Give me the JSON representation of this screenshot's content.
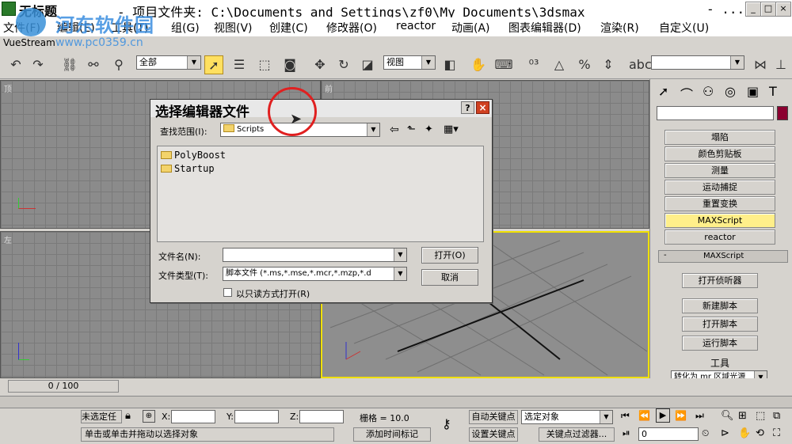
{
  "window": {
    "app_title": "无标题",
    "path": "- 项目文件夹: C:\\Documents and Settings\\zf0\\My Documents\\3dsmax",
    "path_suffix": "- ...",
    "min": "_",
    "max": "□",
    "close": "×"
  },
  "watermark": {
    "site": "河东软件园",
    "url": "www.pc0359.cn"
  },
  "menu": [
    "文件(F)",
    "编辑(E)",
    "工具(T)",
    "组(G)",
    "视图(V)",
    "创建(C)",
    "修改器(O)",
    "reactor",
    "动画(A)",
    "图表编辑器(D)",
    "渲染(R)",
    "自定义(U)"
  ],
  "vustream": "VueStream",
  "toolbar": {
    "selection_filter": "全部",
    "ref_coord": "视图",
    "named_selection": ""
  },
  "viewports": {
    "top": "顶",
    "front": "前",
    "left": "左"
  },
  "command_panel": {
    "buttons": [
      "塌陷",
      "颜色剪贴板",
      "测量",
      "运动捕捉",
      "重置变换",
      "MAXScript",
      "reactor"
    ],
    "highlighted": "MAXScript",
    "rollout_title": "MAXScript",
    "rollout_minus": "-",
    "rollout_buttons": [
      "打开侦听器",
      "新建脚本",
      "打开脚本",
      "运行脚本"
    ],
    "tools_label": "工具",
    "tools_combo": "转化为 mr 区域光源"
  },
  "dialog": {
    "title": "选择编辑器文件",
    "lookin_label": "查找范围(I):",
    "lookin_value": "Scripts",
    "files": [
      "PolyBoost",
      "Startup"
    ],
    "filename_label": "文件名(N):",
    "filename_value": "",
    "filetype_label": "文件类型(T):",
    "filetype_value": "脚本文件 (*.ms,*.mse,*.mcr,*.mzp,*.d",
    "readonly_label": "以只读方式打开(R)",
    "readonly_checked": false,
    "open_button": "打开(O)",
    "cancel_button": "取消",
    "help": "?",
    "close": "×"
  },
  "timeline": {
    "frame": "0 / 100"
  },
  "status": {
    "selection": "未选定任",
    "x_label": "X:",
    "y_label": "Y:",
    "z_label": "Z:",
    "grid": "栅格 = 10.0",
    "autokey": "自动关键点",
    "setkey": "设置关键点",
    "selected_object": "选定对象",
    "key_filters": "关键点过滤器...",
    "prompt": "单击或单击并拖动以选择对象",
    "add_time_tag": "添加时间标记",
    "frame_field": "0"
  },
  "colors": {
    "yellow_border": "#f0e000",
    "highlight": "#ffef8a",
    "swatch": "#8b0030"
  }
}
